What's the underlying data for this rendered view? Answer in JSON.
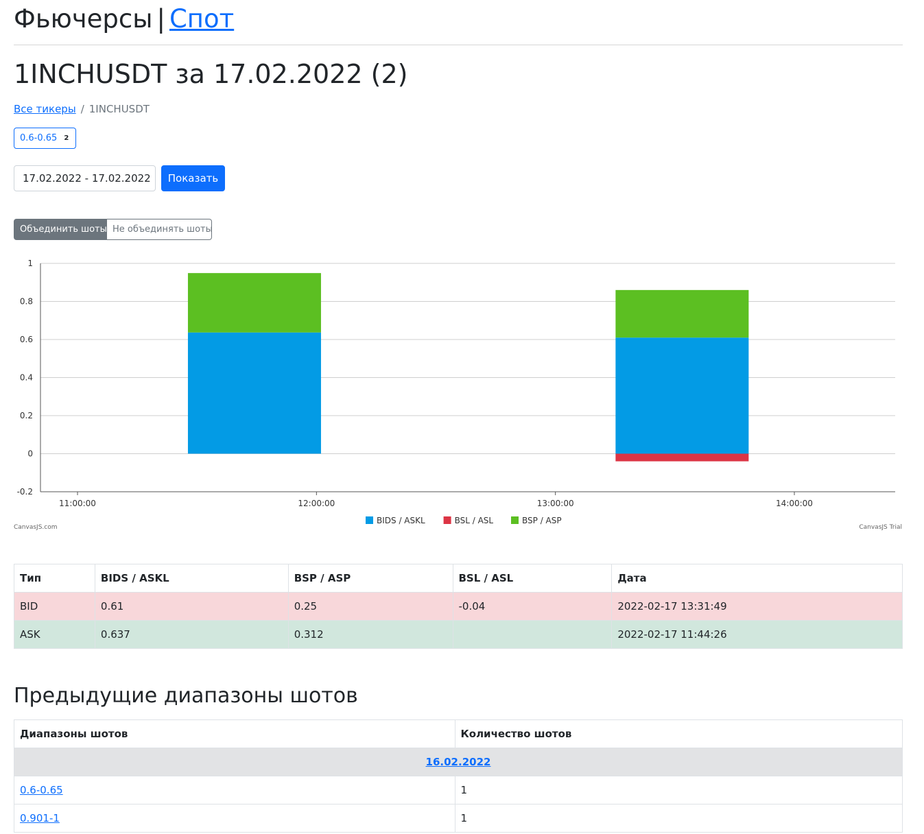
{
  "header": {
    "futures": "Фьючерсы",
    "separator": "|",
    "spot": "Спот"
  },
  "page_title": "1INCHUSDT за 17.02.2022 (2)",
  "breadcrumb": {
    "all": "Все тикеры",
    "divider": "/",
    "current": "1INCHUSDT"
  },
  "range_badge": {
    "label": "0.6-0.65",
    "count": "2"
  },
  "date_filter": {
    "value": "17.02.2022 - 17.02.2022",
    "button": "Показать"
  },
  "merge_toggle": {
    "merge": "Объединить шоты",
    "no_merge": "Не объединять шоты",
    "active": "merge"
  },
  "chart_credit": {
    "left": "CanvasJS.com",
    "right": "CanvasJS Trial"
  },
  "chart_data": {
    "type": "bar",
    "stacked": true,
    "x": [
      "11:44:26",
      "13:31:49"
    ],
    "series": [
      {
        "name": "BIDS / ASKL",
        "color": "#039be5",
        "values": [
          0.637,
          0.61
        ]
      },
      {
        "name": "BSL / ASL",
        "color": "#dc3545",
        "values": [
          0,
          -0.04
        ]
      },
      {
        "name": "BSP / ASP",
        "color": "#5cbf22",
        "values": [
          0.312,
          0.25
        ]
      }
    ],
    "xticks": [
      "11:00:00",
      "12:00:00",
      "13:00:00",
      "14:00:00"
    ],
    "yticks": [
      "1",
      "0.8",
      "0.6",
      "0.4",
      "0.2",
      "0",
      "-0.2"
    ],
    "ylim": [
      -0.2,
      1
    ],
    "grid": true,
    "legend": "bottom-center"
  },
  "table": {
    "headers": [
      "Тип",
      "BIDS / ASKL",
      "BSP / ASP",
      "BSL / ASL",
      "Дата"
    ],
    "rows": [
      [
        "BID",
        "0.61",
        "0.25",
        "-0.04",
        "2022-02-17 13:31:49"
      ],
      [
        "ASK",
        "0.637",
        "0.312",
        "",
        "2022-02-17 11:44:26"
      ]
    ]
  },
  "previous": {
    "title": "Предыдущие диапазоны шотов",
    "headers": [
      "Диапазоны шотов",
      "Количество шотов"
    ],
    "date": "16.02.2022",
    "rows": [
      [
        "0.6-0.65",
        "1"
      ],
      [
        "0.901-1",
        "1"
      ]
    ]
  },
  "colors": {
    "primary": "#0d6efd",
    "secondary": "#6c757d",
    "bid_row": "#f8d7da",
    "ask_row": "#d1e7dd"
  }
}
